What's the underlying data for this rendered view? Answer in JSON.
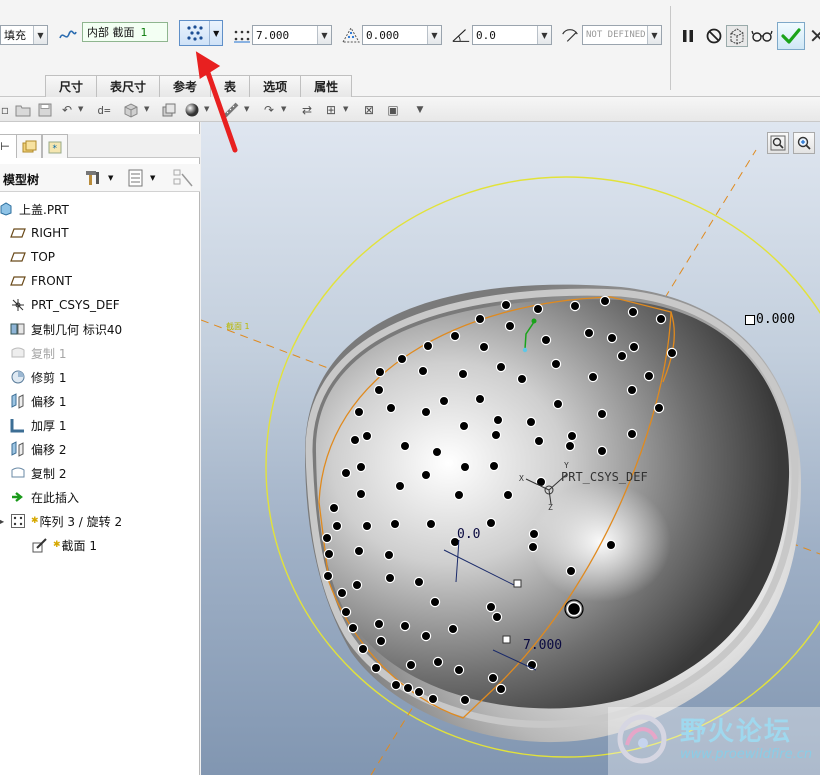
{
  "dashboard": {
    "fill_label": "填充",
    "section_label": "内部 截面",
    "section_number": "1",
    "spacing_value": "7.000",
    "offset_value": "0.000",
    "angle_value": "0.0",
    "undefined_value": "NOT DEFINED",
    "tabs": [
      {
        "label": "尺寸"
      },
      {
        "label": "表尺寸"
      },
      {
        "label": "参考"
      },
      {
        "label": "表"
      },
      {
        "label": "选项"
      },
      {
        "label": "属性"
      }
    ]
  },
  "panel": {
    "title": "模型树",
    "tree": [
      {
        "label": "上盖.PRT",
        "icon": "part-icon"
      },
      {
        "label": "RIGHT",
        "icon": "datum-plane-icon"
      },
      {
        "label": "TOP",
        "icon": "datum-plane-icon"
      },
      {
        "label": "FRONT",
        "icon": "datum-plane-icon"
      },
      {
        "label": "PRT_CSYS_DEF",
        "icon": "csys-icon"
      },
      {
        "label": "复制几何 标识40",
        "icon": "copy-geometry-icon"
      },
      {
        "label": "复制 1",
        "icon": "copy-surface-icon"
      },
      {
        "label": "修剪 1",
        "icon": "trim-icon"
      },
      {
        "label": "偏移 1",
        "icon": "offset-icon"
      },
      {
        "label": "加厚 1",
        "icon": "thicken-icon"
      },
      {
        "label": "偏移 2",
        "icon": "offset-icon"
      },
      {
        "label": "复制 2",
        "icon": "copy-surface-icon"
      },
      {
        "label": "在此插入",
        "icon": "insert-here-icon"
      },
      {
        "label": "阵列 3 / 旋转 2",
        "icon": "pattern-icon"
      },
      {
        "label": "截面 1",
        "icon": "sketch-icon"
      }
    ]
  },
  "viewport": {
    "section_tag": "截面 1",
    "csys_label": "PRT_CSYS_DEF",
    "dim_top": "0.000",
    "dim_angle": "0.0",
    "dim_spacing": "7.000",
    "axis_x": "X",
    "axis_y": "Y",
    "axis_z": "Z"
  },
  "watermark": {
    "title": "野火论坛",
    "url": "www.proewildfire.cn"
  },
  "colors": {
    "accent": "#5f8fc8",
    "ok_green": "#1aa31a",
    "curve_orange": "#e08a1e",
    "circle_yellow": "#e2e23a",
    "annotation_arrow": "#e82020"
  }
}
